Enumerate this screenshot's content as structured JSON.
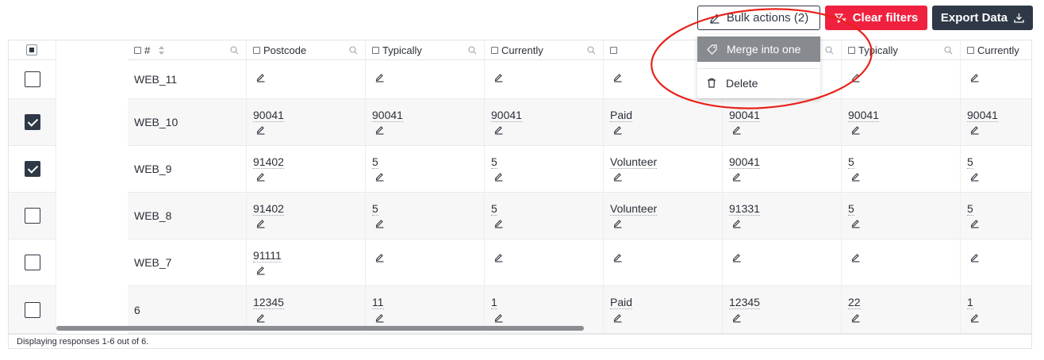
{
  "toolbar": {
    "bulk_label": "Bulk actions (2)",
    "clear_label": "Clear filters",
    "export_label": "Export Data",
    "colors": {
      "danger": "#f0213e",
      "dark": "#2f3847"
    }
  },
  "dropdown": {
    "merge_label": "Merge into one",
    "delete_label": "Delete"
  },
  "table": {
    "headers": [
      "#",
      "Postcode",
      "Typically",
      "Currently",
      "",
      "",
      "Typically",
      "Currently"
    ],
    "rows": [
      {
        "checked": false,
        "id": "WEB_11",
        "cells": [
          "",
          "",
          "",
          "",
          "",
          "",
          ""
        ]
      },
      {
        "checked": true,
        "id": "WEB_10",
        "cells": [
          "90041",
          "90041",
          "90041",
          "Paid",
          "90041",
          "90041",
          "90041"
        ]
      },
      {
        "checked": true,
        "id": "WEB_9",
        "cells": [
          "91402",
          "5",
          "5",
          "Volunteer",
          "90041",
          "5",
          "5"
        ]
      },
      {
        "checked": false,
        "id": "WEB_8",
        "cells": [
          "91402",
          "5",
          "5",
          "Volunteer",
          "91331",
          "5",
          "5"
        ]
      },
      {
        "checked": false,
        "id": "WEB_7",
        "cells": [
          "91111",
          "",
          "",
          "",
          "",
          "",
          ""
        ]
      },
      {
        "checked": false,
        "id": "6",
        "cells": [
          "12345",
          "11",
          "1",
          "Paid",
          "12345",
          "22",
          "1"
        ]
      }
    ]
  },
  "footer": {
    "text": "Displaying responses 1-6 out of 6."
  },
  "annotation_color": "#e8221b"
}
